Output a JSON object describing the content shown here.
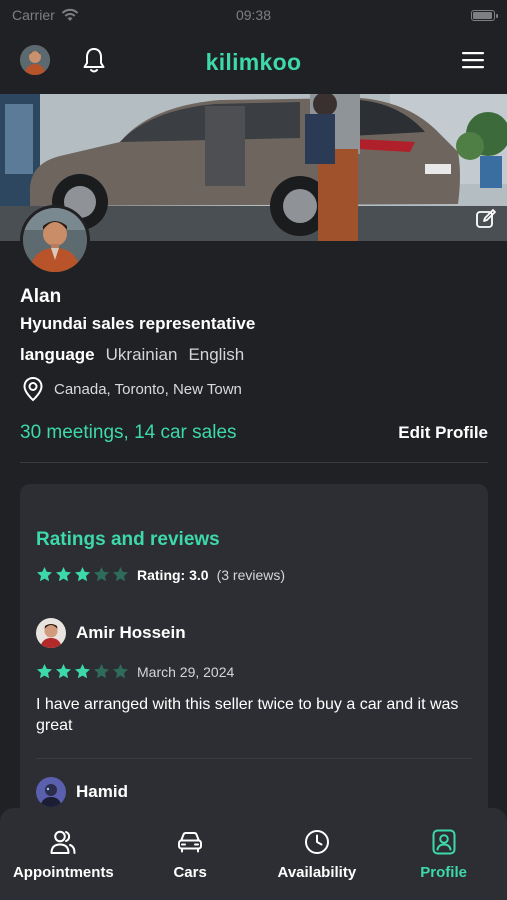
{
  "status_bar": {
    "carrier": "Carrier",
    "time": "09:38",
    "battery_level": 1.0
  },
  "header": {
    "title": "kilimkoo",
    "icons": {
      "avatar": "user-avatar",
      "bell": "bell-icon",
      "menu": "hamburger-menu-icon"
    }
  },
  "cover": {
    "edit_icon": "edit-icon"
  },
  "profile": {
    "name": "Alan",
    "role": "Hyundai sales representative",
    "language_label": "language",
    "languages": [
      "Ukrainian",
      "English"
    ],
    "location": "Canada, Toronto, New Town",
    "stats": "30 meetings, 14 car sales",
    "edit_label": "Edit Profile"
  },
  "ratings": {
    "title": "Ratings and reviews",
    "stars": 3,
    "max_stars": 5,
    "rating_label": "Rating: 3.0",
    "count_label": "(3 reviews)",
    "reviews": [
      {
        "name": "Amir Hossein",
        "stars": 3,
        "date": "March 29, 2024",
        "text": "I have arranged with this seller twice to buy a car and it was great"
      },
      {
        "name": "Hamid"
      }
    ]
  },
  "tabs": [
    {
      "label": "Appointments",
      "icon": "users-icon",
      "active": false
    },
    {
      "label": "Cars",
      "icon": "car-icon",
      "active": false
    },
    {
      "label": "Availability",
      "icon": "clock-icon",
      "active": false
    },
    {
      "label": "Profile",
      "icon": "profile-icon",
      "active": true
    }
  ],
  "colors": {
    "accent": "#3dd9a8",
    "background": "#202124",
    "card": "#2c2e33",
    "star_empty": "#2e6b58"
  }
}
